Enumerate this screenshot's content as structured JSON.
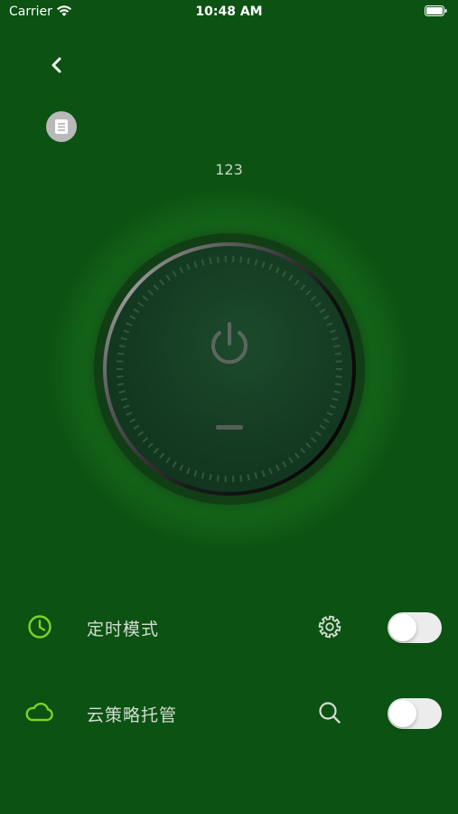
{
  "statusbar": {
    "carrier": "Carrier",
    "time": "10:48 AM"
  },
  "header": {
    "device_name": "123"
  },
  "rows": [
    {
      "label": "定时模式",
      "icon": "clock-icon",
      "action_icon": "gear-icon",
      "toggle_on": false
    },
    {
      "label": "云策略托管",
      "icon": "cloud-icon",
      "action_icon": "search-icon",
      "toggle_on": false
    }
  ],
  "colors": {
    "background": "#0c5212",
    "accent_green": "#7ed321",
    "toggle_off": "#ececec"
  }
}
